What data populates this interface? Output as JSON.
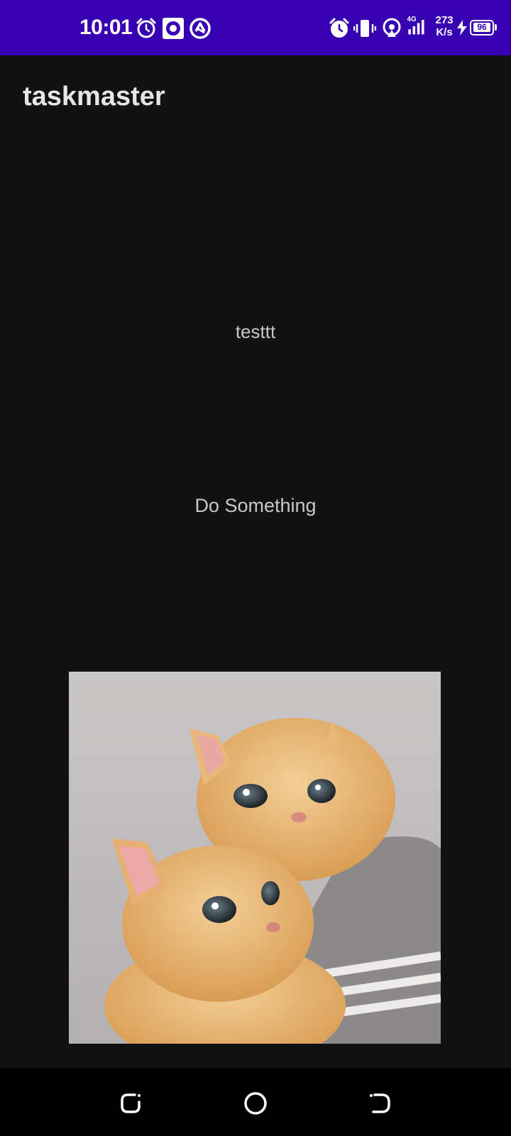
{
  "status_bar": {
    "time": "10:01",
    "network_type": "4G",
    "speed_value": "273",
    "speed_unit": "K/s",
    "battery_level": "96",
    "icons_left": [
      "alarm-icon",
      "music-icon",
      "app-notification-icon"
    ],
    "icons_right": [
      "alarm-icon",
      "vibrate-icon",
      "hotspot-icon",
      "signal-icon",
      "charging-icon",
      "battery-icon"
    ]
  },
  "app_bar": {
    "title": "taskmaster"
  },
  "task": {
    "title": "testtt",
    "description": "Do Something"
  },
  "image": {
    "subject": "two orange kittens hugging"
  },
  "nav_bar": {
    "buttons": [
      "recents-button",
      "home-button",
      "back-button"
    ]
  },
  "colors": {
    "status_bar_bg": "#3700b3",
    "background": "#121212",
    "nav_bar_bg": "#000000",
    "text_primary": "#e6e6e6",
    "text_secondary": "#c8c8c8"
  }
}
